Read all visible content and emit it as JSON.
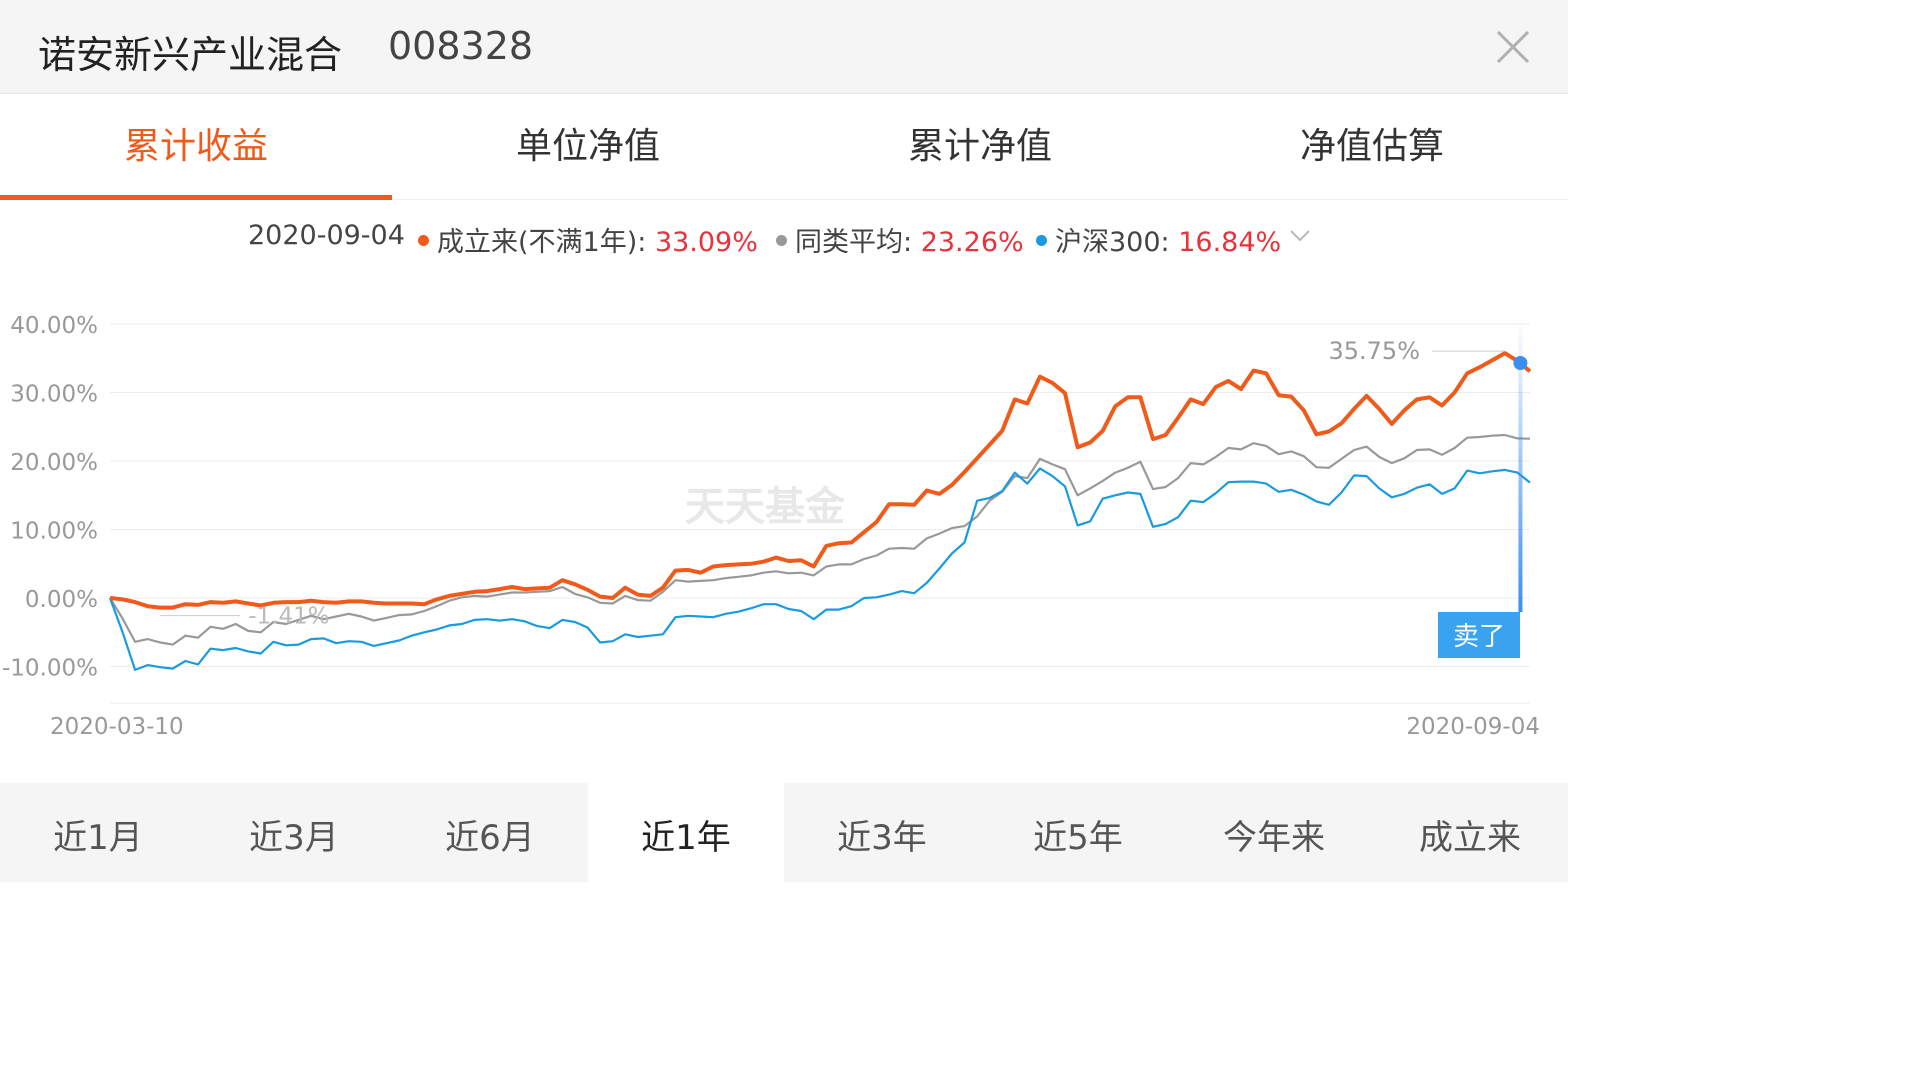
{
  "header": {
    "fund_name": "诺安新兴产业混合",
    "fund_code": "008328",
    "close_icon": "close-icon"
  },
  "tabs": [
    {
      "label": "累计收益",
      "active": true
    },
    {
      "label": "单位净值",
      "active": false
    },
    {
      "label": "累计净值",
      "active": false
    },
    {
      "label": "净值估算",
      "active": false
    }
  ],
  "legend": {
    "date": "2020-09-04",
    "items": [
      {
        "label": "成立来(不满1年):",
        "value": "33.09%",
        "color": "#f05a1a"
      },
      {
        "label": "同类平均:",
        "value": "23.26%",
        "color": "#999999"
      },
      {
        "label": "沪深300:",
        "value": "16.84%",
        "color": "#1a9be0"
      }
    ],
    "expand_icon": "chevron-down-icon"
  },
  "chart_data": {
    "type": "line",
    "x_start": "2020-03-10",
    "x_end": "2020-09-04",
    "ylim": [
      -15,
      40
    ],
    "y_ticks": [
      "40.00%",
      "30.00%",
      "20.00%",
      "10.00%",
      "0.00%",
      "-10.00%"
    ],
    "watermark": "天天基金",
    "annotations": {
      "max_label": "35.75%",
      "min_label": "-1.41%",
      "sell_badge": "卖了"
    },
    "series": [
      {
        "name": "成立来(不满1年)",
        "color": "#f05a1a",
        "values": [
          0,
          -0.2,
          -0.6,
          -1.2,
          -1.4,
          -1.4,
          -0.9,
          -1.0,
          -0.6,
          -0.7,
          -0.5,
          -0.8,
          -1.1,
          -0.7,
          -0.6,
          -0.6,
          -0.4,
          -0.6,
          -0.7,
          -0.5,
          -0.5,
          -0.7,
          -0.8,
          -0.8,
          -0.8,
          -0.9,
          -0.2,
          0.3,
          0.6,
          0.9,
          1.0,
          1.3,
          1.6,
          1.3,
          1.4,
          1.5,
          2.6,
          2.0,
          1.2,
          0.2,
          0.0,
          1.5,
          0.5,
          0.3,
          1.5,
          4.0,
          4.1,
          3.7,
          4.6,
          4.8,
          4.9,
          5.0,
          5.3,
          5.9,
          5.4,
          5.5,
          4.6,
          7.6,
          8.0,
          8.1,
          9.6,
          11.1,
          13.7,
          13.7,
          13.6,
          15.7,
          15.2,
          16.5,
          18.4,
          20.4,
          22.4,
          24.4,
          29.0,
          28.4,
          32.3,
          31.4,
          29.9,
          22.0,
          22.7,
          24.4,
          28.0,
          29.3,
          29.3,
          23.2,
          23.8,
          26.3,
          29.0,
          28.3,
          30.8,
          31.7,
          30.5,
          33.2,
          32.8,
          29.6,
          29.4,
          27.4,
          23.9,
          24.3,
          25.5,
          27.6,
          29.5,
          27.6,
          25.4,
          27.4,
          29.0,
          29.3,
          28.1,
          30.0,
          32.8,
          33.7,
          34.7,
          35.75,
          34.6,
          33.09
        ]
      },
      {
        "name": "同类平均",
        "color": "#999999",
        "values": [
          0,
          -3.0,
          -6.4,
          -6.0,
          -6.5,
          -6.8,
          -5.5,
          -5.8,
          -4.2,
          -4.5,
          -3.8,
          -4.8,
          -5.0,
          -3.5,
          -3.8,
          -3.2,
          -2.6,
          -3.1,
          -2.7,
          -2.3,
          -2.7,
          -3.3,
          -2.9,
          -2.5,
          -2.4,
          -1.9,
          -1.2,
          -0.4,
          0.1,
          0.3,
          0.2,
          0.5,
          0.8,
          0.8,
          0.9,
          1.0,
          1.6,
          0.6,
          0.1,
          -0.7,
          -0.8,
          0.3,
          -0.3,
          -0.4,
          0.9,
          2.6,
          2.4,
          2.5,
          2.6,
          2.9,
          3.1,
          3.3,
          3.7,
          3.9,
          3.6,
          3.7,
          3.3,
          4.6,
          4.9,
          4.9,
          5.7,
          6.2,
          7.2,
          7.3,
          7.2,
          8.7,
          9.4,
          10.2,
          10.5,
          11.9,
          14.2,
          15.5,
          17.8,
          17.5,
          20.3,
          19.5,
          18.8,
          15.0,
          16.0,
          17.1,
          18.3,
          19.0,
          19.9,
          15.9,
          16.2,
          17.5,
          19.7,
          19.5,
          20.6,
          21.9,
          21.7,
          22.6,
          22.2,
          21.0,
          21.4,
          20.7,
          19.1,
          19.0,
          20.3,
          21.6,
          22.1,
          20.6,
          19.7,
          20.4,
          21.6,
          21.7,
          20.9,
          21.9,
          23.4,
          23.5,
          23.7,
          23.8,
          23.3,
          23.26
        ]
      },
      {
        "name": "沪深300",
        "color": "#1a9be0",
        "values": [
          0,
          -5.0,
          -10.5,
          -9.8,
          -10.1,
          -10.3,
          -9.2,
          -9.7,
          -7.4,
          -7.6,
          -7.3,
          -7.8,
          -8.1,
          -6.4,
          -6.9,
          -6.8,
          -6.0,
          -5.9,
          -6.6,
          -6.3,
          -6.4,
          -7.0,
          -6.6,
          -6.2,
          -5.5,
          -5.0,
          -4.6,
          -4.0,
          -3.8,
          -3.2,
          -3.1,
          -3.3,
          -3.1,
          -3.4,
          -4.1,
          -4.4,
          -3.2,
          -3.5,
          -4.3,
          -6.5,
          -6.3,
          -5.3,
          -5.7,
          -5.5,
          -5.3,
          -2.8,
          -2.6,
          -2.7,
          -2.8,
          -2.3,
          -2.0,
          -1.5,
          -0.9,
          -0.9,
          -1.6,
          -1.9,
          -3.1,
          -1.7,
          -1.7,
          -1.2,
          0.0,
          0.1,
          0.5,
          1.0,
          0.7,
          2.2,
          4.3,
          6.5,
          8.1,
          14.2,
          14.6,
          15.6,
          18.3,
          16.7,
          18.9,
          17.8,
          16.3,
          10.6,
          11.2,
          14.5,
          15.0,
          15.4,
          15.2,
          10.4,
          10.8,
          11.8,
          14.2,
          14.0,
          15.3,
          16.9,
          17.0,
          17.0,
          16.7,
          15.5,
          15.8,
          15.1,
          14.1,
          13.6,
          15.4,
          17.9,
          17.8,
          16.0,
          14.7,
          15.2,
          16.1,
          16.6,
          15.2,
          16.0,
          18.6,
          18.2,
          18.5,
          18.7,
          18.3,
          16.84
        ]
      }
    ]
  },
  "periods": [
    {
      "label": "近1月",
      "active": false
    },
    {
      "label": "近3月",
      "active": false
    },
    {
      "label": "近6月",
      "active": false
    },
    {
      "label": "近1年",
      "active": true
    },
    {
      "label": "近3年",
      "active": false
    },
    {
      "label": "近5年",
      "active": false
    },
    {
      "label": "今年来",
      "active": false
    },
    {
      "label": "成立来",
      "active": false
    }
  ]
}
